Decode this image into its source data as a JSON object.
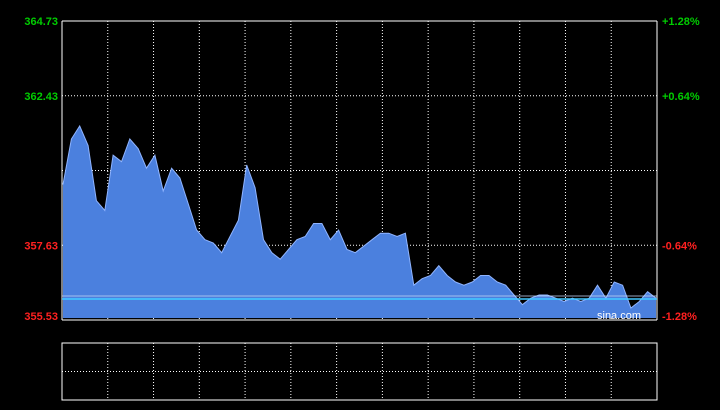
{
  "watermark": "sina.com",
  "colors": {
    "background": "#000000",
    "grid": "#ffffff",
    "up": "#00cc00",
    "down": "#ff2020",
    "fill": "#4f86e8",
    "fill_line": "#8fb4ff",
    "baseline": "#40c8ff"
  },
  "chart_data": {
    "type": "area",
    "title": "",
    "xlabel": "",
    "ylabel": "",
    "ylim": [
      355.53,
      364.73
    ],
    "grid": true,
    "left_ticks": [
      "364.73",
      "362.43",
      "357.63",
      "355.53"
    ],
    "right_ticks": [
      "+1.28%",
      "+0.64%",
      "-0.64%",
      "-1.28%"
    ],
    "left_tick_values": [
      364.73,
      362.43,
      357.63,
      355.53
    ],
    "series": [
      {
        "values": [
          359.7,
          361.1,
          361.5,
          360.9,
          359.2,
          358.9,
          360.6,
          360.4,
          361.1,
          360.8,
          360.2,
          360.6,
          359.5,
          360.2,
          359.9,
          359.1,
          358.3,
          358.0,
          357.9,
          357.6,
          358.1,
          358.6,
          360.3,
          359.6,
          358.0,
          357.6,
          357.4,
          357.7,
          358.0,
          358.1,
          358.5,
          358.5,
          358.0,
          358.3,
          357.7,
          357.6,
          357.8,
          358.0,
          358.2,
          358.2,
          358.1,
          358.2,
          356.6,
          356.8,
          356.9,
          357.2,
          356.9,
          356.7,
          356.6,
          356.7,
          356.9,
          356.9,
          356.7,
          356.6,
          356.3,
          356.0,
          356.2,
          356.3,
          356.3,
          356.2,
          356.1,
          356.2,
          356.1,
          356.2,
          356.6,
          356.2,
          356.7,
          356.6,
          355.9,
          356.1,
          356.4,
          356.2
        ]
      }
    ]
  },
  "lower_panel": {
    "type": "volume",
    "values": []
  }
}
